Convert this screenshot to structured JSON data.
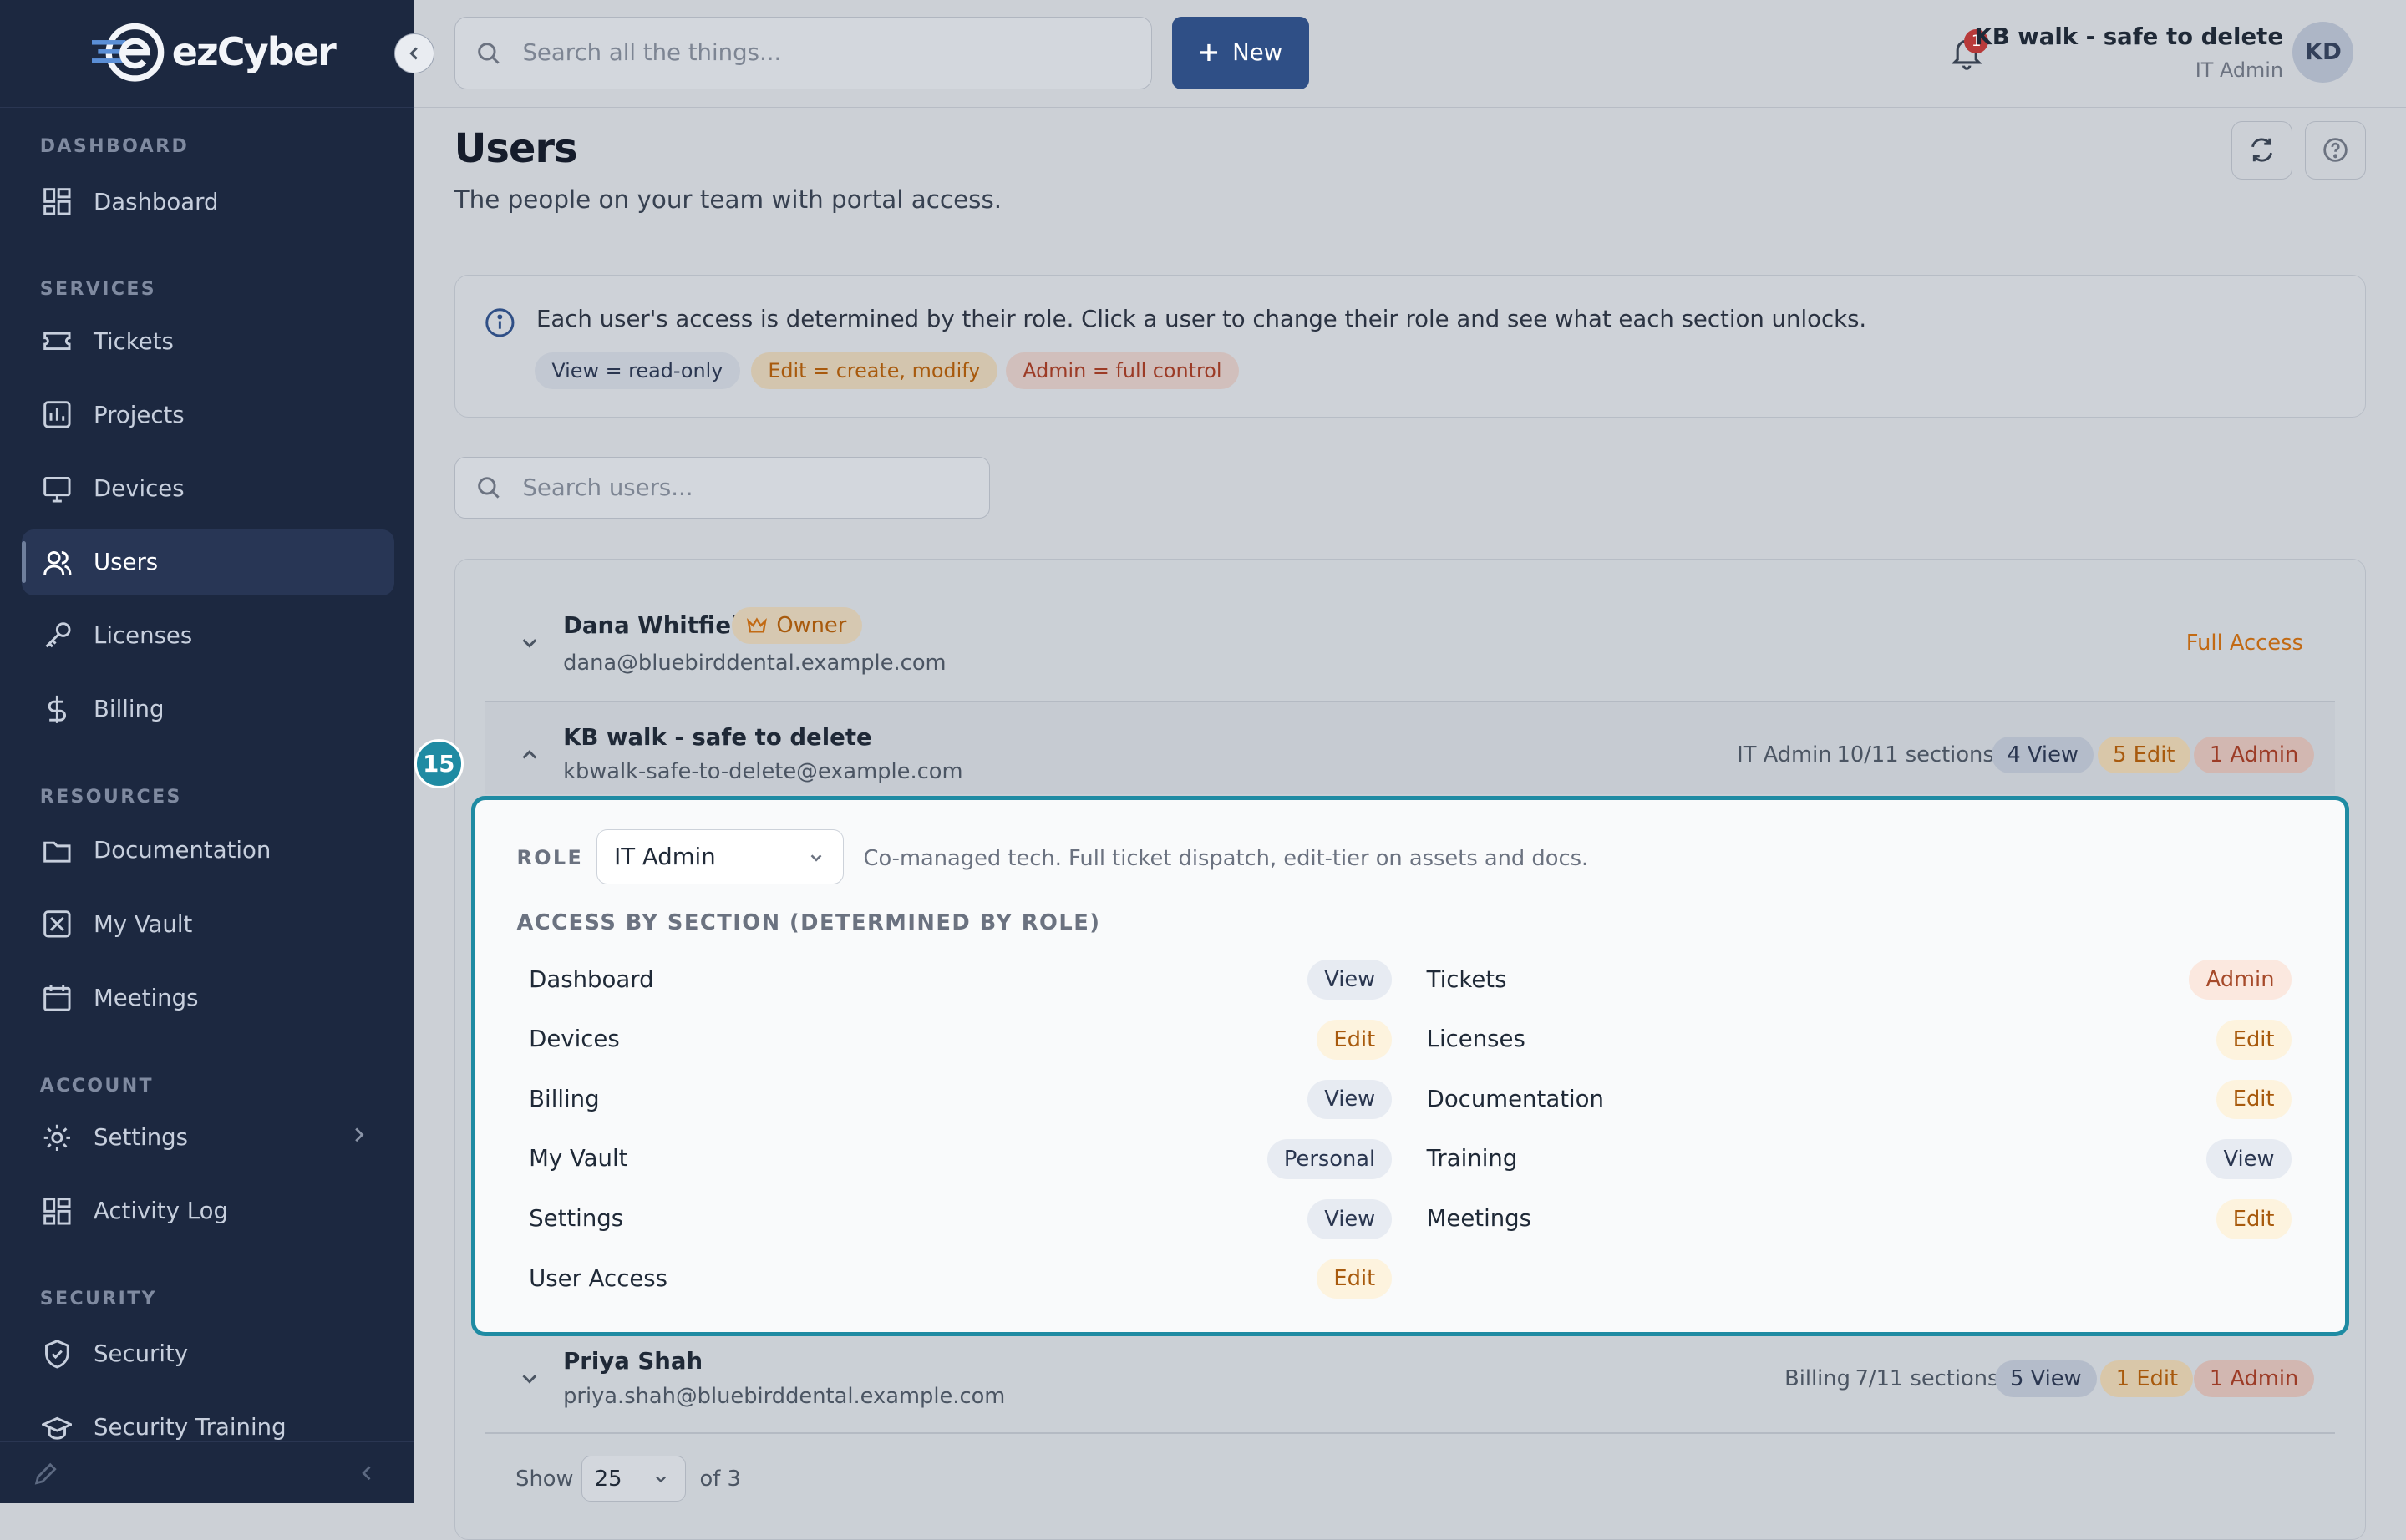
{
  "sidebar": {
    "logo_text": "ezCyber",
    "sections": {
      "dashboard": "DASHBOARD",
      "services": "SERVICES",
      "resources": "RESOURCES",
      "account": "ACCOUNT",
      "security": "SECURITY"
    },
    "items": {
      "dashboard": "Dashboard",
      "tickets": "Tickets",
      "projects": "Projects",
      "devices": "Devices",
      "users": "Users",
      "licenses": "Licenses",
      "billing": "Billing",
      "documentation": "Documentation",
      "my_vault": "My Vault",
      "meetings": "Meetings",
      "settings": "Settings",
      "activity_log": "Activity Log",
      "security": "Security",
      "security_training": "Security Training"
    }
  },
  "topbar": {
    "search_placeholder": "Search all the things...",
    "new_label": "New",
    "notification_count": "1",
    "user_name": "KB walk - safe to delete",
    "user_role": "IT Admin",
    "avatar_initials": "KD"
  },
  "page": {
    "title": "Users",
    "subtitle": "The people on your team with portal access.",
    "info_text": "Each user's access is determined by their role. Click a user to change their role and see what each section unlocks.",
    "chips": {
      "view": "View = read-only",
      "edit": "Edit = create, modify",
      "admin": "Admin = full control"
    },
    "search_users_placeholder": "Search users..."
  },
  "users": [
    {
      "name": "Dana Whitfield",
      "badge": "Owner",
      "email": "dana@bluebirddental.example.com",
      "access": "Full Access"
    },
    {
      "name": "KB walk - safe to delete",
      "email": "kbwalk-safe-to-delete@example.com",
      "role": "IT Admin",
      "sections": "10/11 sections",
      "view": "4 View",
      "edit": "5 Edit",
      "admin": "1 Admin"
    },
    {
      "name": "Priya Shah",
      "email": "priya.shah@bluebirddental.example.com",
      "role": "Billing",
      "sections": "7/11 sections",
      "view": "5 View",
      "edit": "1 Edit",
      "admin": "1 Admin"
    }
  ],
  "panel": {
    "role_label": "ROLE",
    "role_value": "IT Admin",
    "role_desc": "Co-managed tech. Full ticket dispatch, edit-tier on assets and docs.",
    "access_title": "ACCESS BY SECTION (DETERMINED BY ROLE)",
    "left": [
      {
        "name": "Dashboard",
        "level": "View"
      },
      {
        "name": "Devices",
        "level": "Edit"
      },
      {
        "name": "Billing",
        "level": "View"
      },
      {
        "name": "My Vault",
        "level": "Personal"
      },
      {
        "name": "Settings",
        "level": "View"
      },
      {
        "name": "User Access",
        "level": "Edit"
      }
    ],
    "right": [
      {
        "name": "Tickets",
        "level": "Admin"
      },
      {
        "name": "Licenses",
        "level": "Edit"
      },
      {
        "name": "Documentation",
        "level": "Edit"
      },
      {
        "name": "Training",
        "level": "View"
      },
      {
        "name": "Meetings",
        "level": "Edit"
      }
    ]
  },
  "step_badge": "15",
  "pagination": {
    "show_label": "Show",
    "page_size": "25",
    "of_label": "of 3"
  },
  "colors": {
    "sidebar_bg": "#1c2840",
    "accent": "#2f4f86",
    "highlight": "#1f8ba3"
  }
}
